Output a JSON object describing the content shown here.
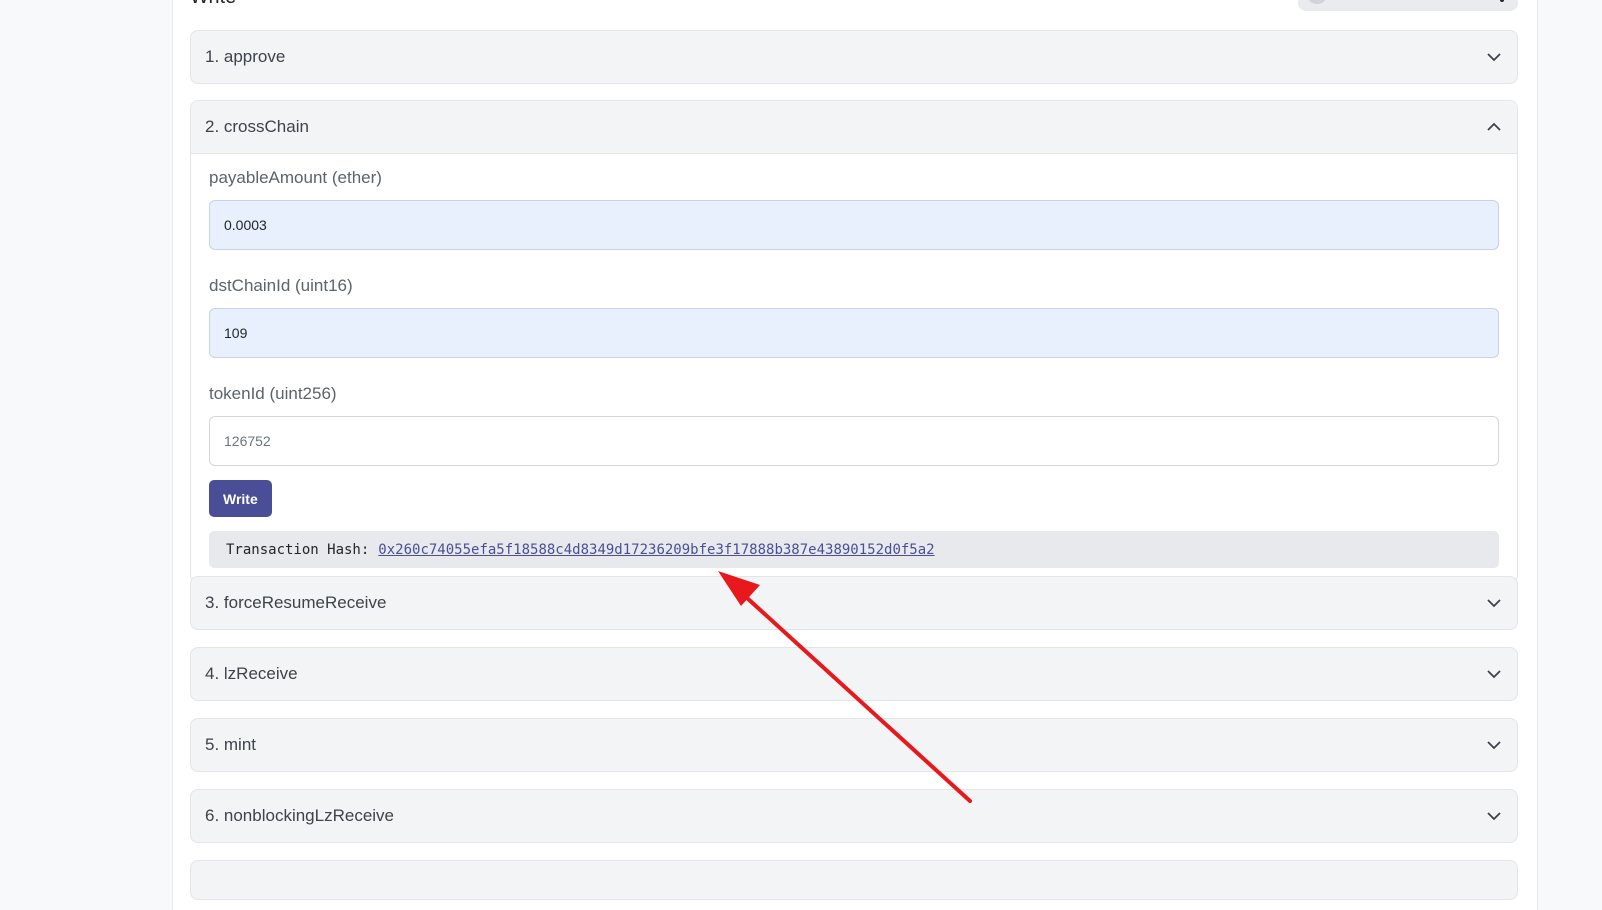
{
  "section": {
    "title": "Write"
  },
  "functions": [
    {
      "label": "1. approve",
      "expanded": false
    },
    {
      "label": "2. crossChain",
      "expanded": true
    },
    {
      "label": "3. forceResumeReceive",
      "expanded": false
    },
    {
      "label": "4. lzReceive",
      "expanded": false
    },
    {
      "label": "5. mint",
      "expanded": false
    },
    {
      "label": "6. nonblockingLzReceive",
      "expanded": false
    }
  ],
  "crossChain": {
    "fields": [
      {
        "label": "payableAmount (ether)",
        "value": "0.0003",
        "placeholder": ""
      },
      {
        "label": "dstChainId (uint16)",
        "value": "109",
        "placeholder": ""
      },
      {
        "label": "tokenId (uint256)",
        "value": "",
        "placeholder": "126752"
      }
    ],
    "write_label": "Write",
    "tx_label": "Transaction Hash:",
    "tx_hash": "0x260c74055efa5f18588c4d8349d17236209bfe3f17888b387e43890152d0f5a2"
  },
  "annotation": {
    "color": "#e8191d"
  }
}
